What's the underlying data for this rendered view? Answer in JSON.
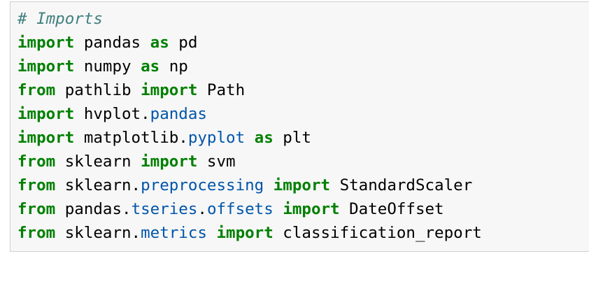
{
  "code_cell": {
    "lines": [
      [
        {
          "type": "comment",
          "text": "# Imports"
        }
      ],
      [
        {
          "type": "keyword",
          "text": "import"
        },
        {
          "type": "name",
          "text": " pandas "
        },
        {
          "type": "keyword",
          "text": "as"
        },
        {
          "type": "name",
          "text": " pd"
        }
      ],
      [
        {
          "type": "keyword",
          "text": "import"
        },
        {
          "type": "name",
          "text": " numpy "
        },
        {
          "type": "keyword",
          "text": "as"
        },
        {
          "type": "name",
          "text": " np"
        }
      ],
      [
        {
          "type": "keyword",
          "text": "from"
        },
        {
          "type": "name",
          "text": " pathlib "
        },
        {
          "type": "keyword",
          "text": "import"
        },
        {
          "type": "name",
          "text": " Path"
        }
      ],
      [
        {
          "type": "keyword",
          "text": "import"
        },
        {
          "type": "name",
          "text": " hvplot."
        },
        {
          "type": "module",
          "text": "pandas"
        }
      ],
      [
        {
          "type": "keyword",
          "text": "import"
        },
        {
          "type": "name",
          "text": " matplotlib."
        },
        {
          "type": "module",
          "text": "pyplot"
        },
        {
          "type": "name",
          "text": " "
        },
        {
          "type": "keyword",
          "text": "as"
        },
        {
          "type": "name",
          "text": " plt"
        }
      ],
      [
        {
          "type": "keyword",
          "text": "from"
        },
        {
          "type": "name",
          "text": " sklearn "
        },
        {
          "type": "keyword",
          "text": "import"
        },
        {
          "type": "name",
          "text": " svm"
        }
      ],
      [
        {
          "type": "keyword",
          "text": "from"
        },
        {
          "type": "name",
          "text": " sklearn."
        },
        {
          "type": "module",
          "text": "preprocessing"
        },
        {
          "type": "name",
          "text": " "
        },
        {
          "type": "keyword",
          "text": "import"
        },
        {
          "type": "name",
          "text": " StandardScaler"
        }
      ],
      [
        {
          "type": "keyword",
          "text": "from"
        },
        {
          "type": "name",
          "text": " pandas."
        },
        {
          "type": "module",
          "text": "tseries"
        },
        {
          "type": "name",
          "text": "."
        },
        {
          "type": "module",
          "text": "offsets"
        },
        {
          "type": "name",
          "text": " "
        },
        {
          "type": "keyword",
          "text": "import"
        },
        {
          "type": "name",
          "text": " DateOffset"
        }
      ],
      [
        {
          "type": "keyword",
          "text": "from"
        },
        {
          "type": "name",
          "text": " sklearn."
        },
        {
          "type": "module",
          "text": "metrics"
        },
        {
          "type": "name",
          "text": " "
        },
        {
          "type": "keyword",
          "text": "import"
        },
        {
          "type": "name",
          "text": " classification_report"
        }
      ]
    ]
  },
  "colors": {
    "cell_background": "#f7f7f7",
    "cell_border": "#cfcfcf",
    "comment": "#408080",
    "keyword": "#008000",
    "module": "#0055aa",
    "text": "#000000"
  }
}
